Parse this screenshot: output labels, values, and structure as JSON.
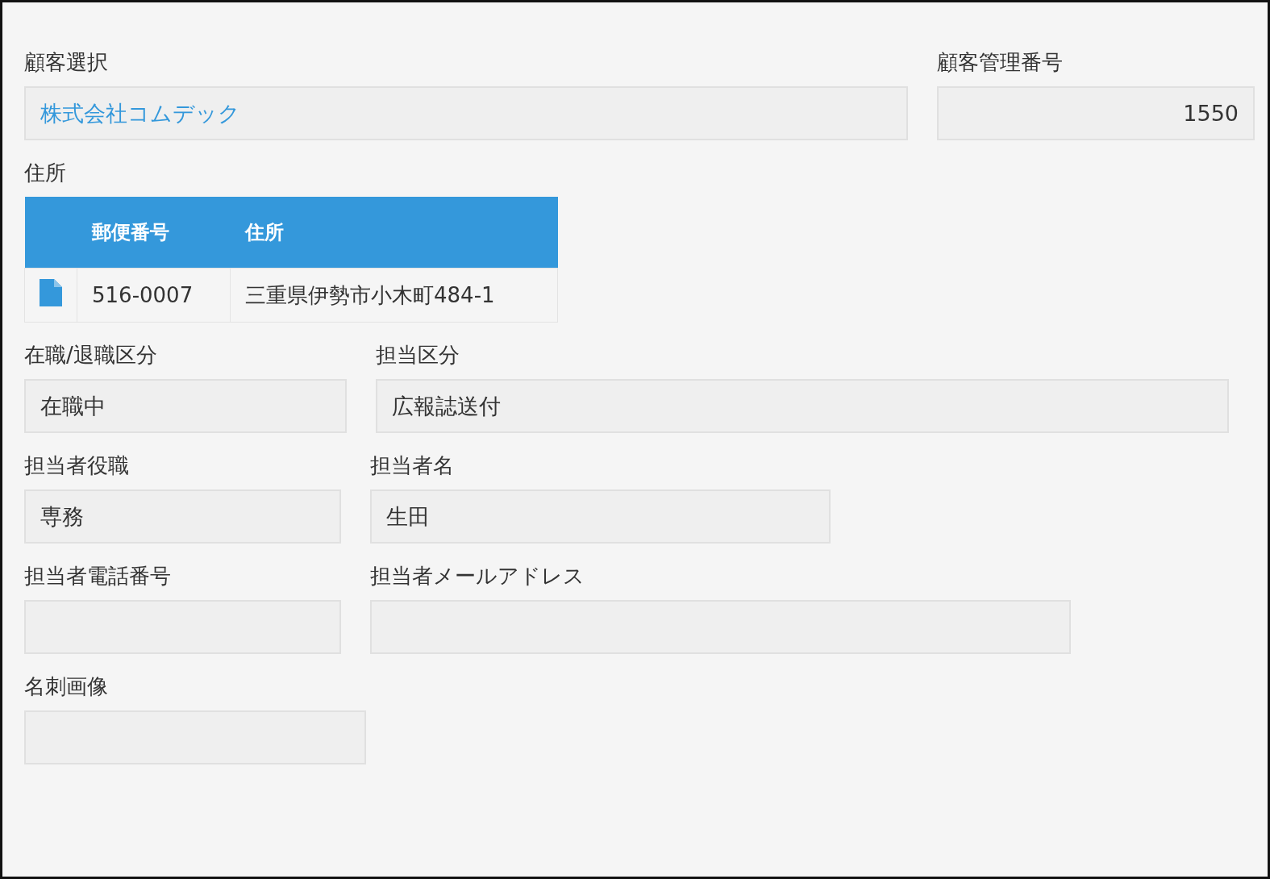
{
  "rows": [
    {
      "fields": [
        {
          "label": "顧客選択",
          "kind": "link",
          "value": "株式会社コムデック"
        },
        {
          "label": "顧客管理番号",
          "kind": "number",
          "value": "1550"
        }
      ]
    },
    {
      "table": {
        "label": "住所",
        "columns": [
          "郵便番号",
          "住所"
        ],
        "rows": [
          {
            "cells": [
              "516-0007",
              "三重県伊勢市小木町484-1"
            ]
          }
        ]
      }
    },
    {
      "fields": [
        {
          "label": "在職/退職区分",
          "kind": "text",
          "value": "在職中"
        },
        {
          "label": "担当区分",
          "kind": "text",
          "value": "広報誌送付"
        }
      ]
    },
    {
      "fields": [
        {
          "label": "担当者役職",
          "kind": "text",
          "value": "専務"
        },
        {
          "label": "担当者名",
          "kind": "text",
          "value": "生田"
        }
      ]
    },
    {
      "fields": [
        {
          "label": "担当者電話番号",
          "kind": "text"
        },
        {
          "label": "担当者メールアドレス",
          "kind": "text"
        }
      ]
    },
    {
      "fields": [
        {
          "label": "名刺画像",
          "kind": "text"
        }
      ]
    }
  ]
}
